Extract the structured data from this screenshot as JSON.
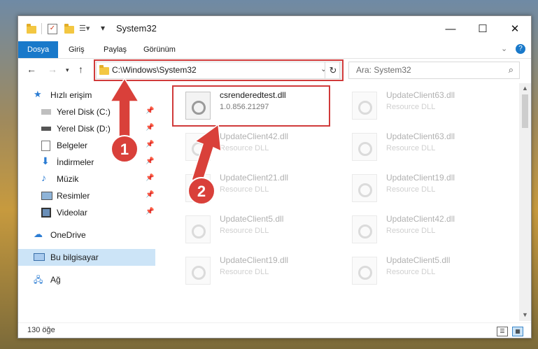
{
  "window": {
    "title": "System32"
  },
  "ribbon": {
    "tabs": [
      "Dosya",
      "Giriş",
      "Paylaş",
      "Görünüm"
    ]
  },
  "address": {
    "path": "C:\\Windows\\System32"
  },
  "search": {
    "placeholder": "Ara: System32"
  },
  "sidebar": {
    "quick_access": "Hızlı erişim",
    "items": [
      "Yerel Disk (C:)",
      "Yerel Disk (D:)",
      "Belgeler",
      "İndirmeler",
      "Müzik",
      "Resimler",
      "Videolar"
    ],
    "onedrive": "OneDrive",
    "this_pc": "Bu bilgisayar",
    "network": "Ağ"
  },
  "files": [
    {
      "name": "csrenderedtest.dll",
      "desc": "1.0.856.21297"
    },
    {
      "name": "UpdateClient63.dll",
      "desc": "Resource DLL"
    },
    {
      "name": "UpdateClient42.dll",
      "desc": "Resource DLL"
    },
    {
      "name": "UpdateClient63.dll",
      "desc": "Resource DLL"
    },
    {
      "name": "UpdateClient21.dll",
      "desc": "Resource DLL"
    },
    {
      "name": "UpdateClient19.dll",
      "desc": "Resource DLL"
    },
    {
      "name": "UpdateClient5.dll",
      "desc": "Resource DLL"
    },
    {
      "name": "UpdateClient42.dll",
      "desc": "Resource DLL"
    },
    {
      "name": "UpdateClient19.dll",
      "desc": "Resource DLL"
    },
    {
      "name": "UpdateClient5.dll",
      "desc": "Resource DLL"
    }
  ],
  "status": {
    "count": "130 öğe"
  },
  "annotations": {
    "one": "1",
    "two": "2",
    "color": "#d9403a"
  }
}
